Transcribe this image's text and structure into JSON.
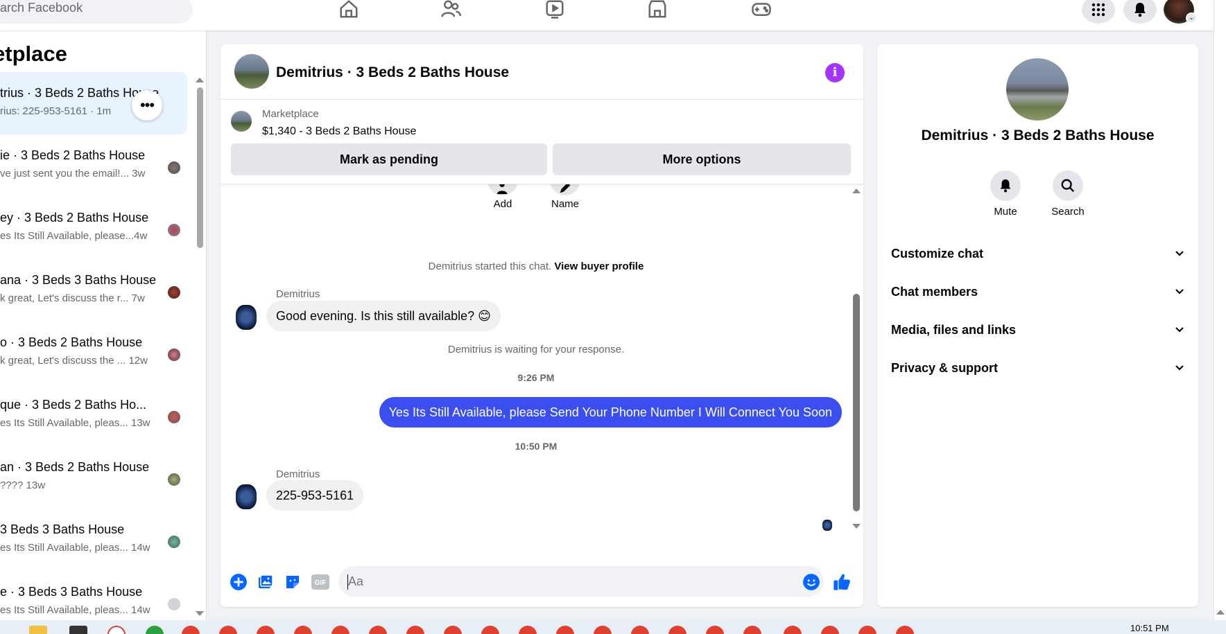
{
  "topbar": {
    "search_placeholder": "Search Facebook",
    "search_visible": "arch Facebook",
    "nav_icons": [
      "home-icon",
      "friends-icon",
      "watch-icon",
      "marketplace-icon",
      "gaming-icon"
    ],
    "right_icons": [
      "menu-grid-icon",
      "notifications-icon",
      "profile-avatar"
    ]
  },
  "sidebar": {
    "title": "etplace",
    "conversations": [
      {
        "title": "trius · 3 Beds 2 Baths House",
        "subtitle": "rius: 225-953-5161 · 1m",
        "active": true
      },
      {
        "title": "ie · 3 Beds 2 Baths House",
        "subtitle": "ve just sent you the email!...",
        "time": "3w"
      },
      {
        "title": "ey · 3 Beds 2 Baths House",
        "subtitle": "es Its Still Available, please...",
        "time": "4w"
      },
      {
        "title": "ana · 3 Beds 3 Baths House",
        "subtitle": "k great, Let's discuss the r...",
        "time": "7w"
      },
      {
        "title": "o · 3 Beds 2 Baths House",
        "subtitle": "k great, Let's discuss the ...",
        "time": "12w"
      },
      {
        "title": "que · 3 Beds 2 Baths Ho...",
        "subtitle": "es Its Still Available, pleas...",
        "time": "13w"
      },
      {
        "title": "an · 3 Beds 2 Baths House",
        "subtitle": "????",
        "time": "13w"
      },
      {
        "title": "3 Beds 3 Baths House",
        "subtitle": "es Its Still Available, pleas...",
        "time": "14w"
      },
      {
        "title": "e · 3 Beds 3 Baths House",
        "subtitle": "es Its Still Available, pleas...",
        "time": "14w"
      }
    ],
    "more_label": "•••"
  },
  "chat": {
    "title": "Demitrius · 3 Beds 2 Baths House",
    "marketplace_label": "Marketplace",
    "listing": "$1,340 - 3 Beds 2 Baths House",
    "mark_pending": "Mark as pending",
    "more_options": "More options",
    "actions": [
      {
        "label": "Add"
      },
      {
        "label": "Name"
      }
    ],
    "started_text": "Demitrius started this chat.",
    "view_profile": "View buyer profile",
    "sender_1": "Demitrius",
    "msg_1": "Good evening. Is this still available? 😊",
    "waiting": "Demitrius is waiting for your response.",
    "time_1": "9:26 PM",
    "msg_out": "Yes Its Still Available, please Send Your Phone Number I Will Connect You Soon",
    "time_2": "10:50 PM",
    "sender_2": "Demitrius",
    "msg_2": "225-953-5161",
    "composer_placeholder": "Aa"
  },
  "info": {
    "name": "Demitrius · 3 Beds 2 Baths House",
    "mute": "Mute",
    "search": "Search",
    "sections": [
      "Customize chat",
      "Chat members",
      "Media, files and links",
      "Privacy & support"
    ]
  },
  "taskbar": {
    "clock": "10:51 PM"
  },
  "colors": {
    "accent": "#3b4ef0",
    "info_purple": "#a334fa",
    "like_blue": "#0866ff"
  }
}
